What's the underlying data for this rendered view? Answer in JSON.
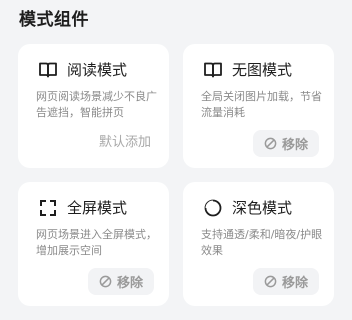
{
  "section": {
    "title": "模式组件"
  },
  "cards": [
    {
      "icon": "book-icon",
      "title": "阅读模式",
      "description": "网页阅读场景减少不良广告遮挡，智能拼页",
      "action": "默认添加"
    },
    {
      "icon": "book-icon",
      "title": "无图模式",
      "description": "全局关闭图片加载，节省流量消耗",
      "action": "移除"
    },
    {
      "icon": "fullscreen-icon",
      "title": "全屏模式",
      "description": "网页场景进入全屏模式，增加展示空间",
      "action": "移除"
    },
    {
      "icon": "moon-icon",
      "title": "深色模式",
      "description": "支持通透/柔和/暗夜/护眼效果",
      "action": "移除"
    }
  ],
  "colors": {
    "background": "#f3f4f6",
    "card": "#ffffff",
    "button_bg": "#f2f3f5",
    "muted_text": "#8a8a8a",
    "action_text": "#9a9a9a"
  }
}
